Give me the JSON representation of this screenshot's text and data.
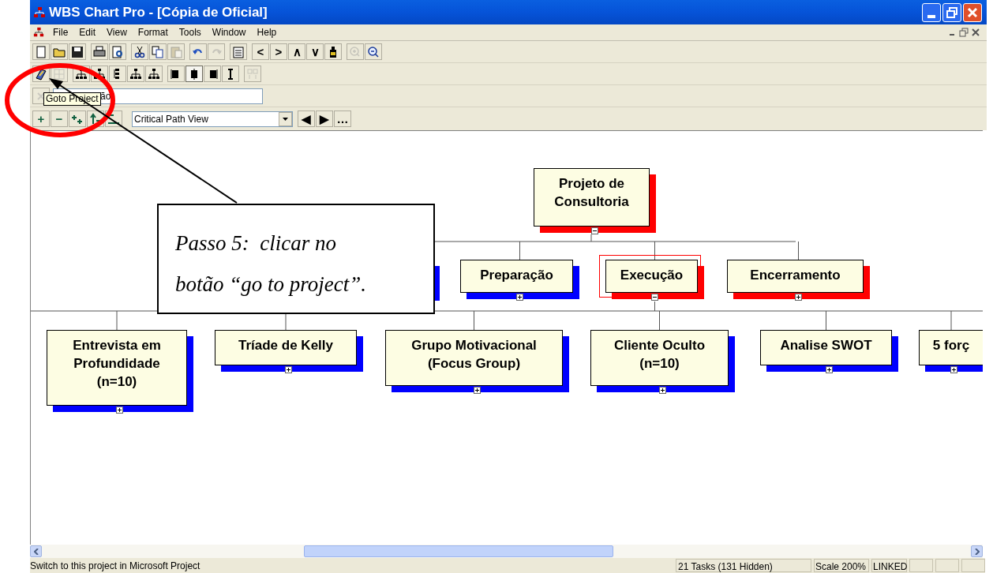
{
  "window": {
    "title": "WBS Chart Pro - [Cópia de Oficial]"
  },
  "menu": [
    "File",
    "Edit",
    "View",
    "Format",
    "Tools",
    "Window",
    "Help"
  ],
  "toolbar_1": [
    [
      {
        "kind": "icon",
        "disabled": false
      },
      {
        "kind": "icon",
        "disabled": false
      },
      {
        "kind": "icon",
        "disabled": false
      }
    ],
    [
      {
        "kind": "icon",
        "disabled": false
      },
      {
        "kind": "icon",
        "disabled": false
      }
    ],
    [
      {
        "kind": "icon",
        "disabled": false
      },
      {
        "kind": "icon",
        "disabled": false
      },
      {
        "kind": "icon",
        "disabled": true
      }
    ],
    [
      {
        "kind": "icon",
        "disabled": false
      },
      {
        "kind": "icon",
        "disabled": true
      }
    ],
    [
      {
        "kind": "icon",
        "disabled": false
      }
    ],
    [
      {
        "kind": "glyph",
        "text": "<",
        "disabled": false
      },
      {
        "kind": "glyph",
        "text": ">",
        "disabled": false
      },
      {
        "kind": "glyph",
        "text": "∧",
        "disabled": false
      },
      {
        "kind": "glyph",
        "text": "∨",
        "disabled": false
      },
      {
        "kind": "icon",
        "disabled": false
      }
    ],
    [
      {
        "kind": "icon",
        "disabled": true
      },
      {
        "kind": "icon",
        "disabled": false
      }
    ]
  ],
  "toolbar_2": [
    [
      {
        "kind": "icon",
        "disabled": false,
        "selected": false
      },
      {
        "kind": "icon",
        "disabled": true,
        "selected": false
      }
    ],
    [
      {
        "kind": "icon",
        "disabled": false,
        "selected": false
      },
      {
        "kind": "icon",
        "disabled": false,
        "selected": false
      },
      {
        "kind": "icon",
        "disabled": false,
        "selected": false
      },
      {
        "kind": "icon",
        "disabled": false,
        "selected": false
      },
      {
        "kind": "icon",
        "disabled": false,
        "selected": false
      }
    ],
    [
      {
        "kind": "icon",
        "disabled": false,
        "selected": false
      },
      {
        "kind": "icon",
        "disabled": false,
        "selected": true
      },
      {
        "kind": "icon",
        "disabled": false,
        "selected": false
      },
      {
        "kind": "icon",
        "disabled": false,
        "selected": false
      }
    ],
    [
      {
        "kind": "icon",
        "disabled": true,
        "selected": false
      }
    ]
  ],
  "task_field": {
    "button_disabled": true,
    "value": "ão"
  },
  "toolbar_4": {
    "buttons": [
      {
        "kind": "glyph",
        "text": "+"
      },
      {
        "kind": "glyph",
        "text": "−"
      },
      {
        "kind": "icon"
      },
      {
        "kind": "icon"
      },
      {
        "kind": "icon"
      }
    ],
    "view_select": {
      "value": "Critical Path View"
    },
    "nav": [
      "◀",
      "▶",
      "…"
    ]
  },
  "tooltip": "Goto Project",
  "chart": {
    "root": {
      "label": "Projeto de Consultoria",
      "color": "#ff0000",
      "expanded": true,
      "selected": false,
      "children": [
        {
          "label": "Preparação",
          "color": "#0000ff",
          "expanded": false,
          "selected": false
        },
        {
          "label": "Execução",
          "color": "#ff0000",
          "expanded": true,
          "selected": true,
          "children": [
            {
              "label": "Entrevista em Profundidade (n=10)",
              "color": "#0000ff",
              "expanded": false,
              "selected": false
            },
            {
              "label": "Tríade de Kelly",
              "color": "#0000ff",
              "expanded": false,
              "selected": false
            },
            {
              "label": "Grupo Motivacional (Focus Group)",
              "color": "#0000ff",
              "expanded": false,
              "selected": false
            },
            {
              "label": "Cliente Oculto (n=10)",
              "color": "#0000ff",
              "expanded": false,
              "selected": false
            },
            {
              "label": "Analise SWOT",
              "color": "#0000ff",
              "expanded": false,
              "selected": false
            },
            {
              "label": "5 forç",
              "color": "#0000ff",
              "expanded": false,
              "selected": false
            }
          ]
        },
        {
          "label": "Encerramento",
          "color": "#ff0000",
          "expanded": false,
          "selected": false
        }
      ]
    }
  },
  "callout": {
    "lines": [
      "Passo 5:  clicar no",
      "botão “go to project”."
    ]
  },
  "status_bar": {
    "message": "Switch to this project in Microsoft Project",
    "tasks": "21 Tasks (131 Hidden)",
    "scale": "Scale 200%",
    "mode": "LINKED"
  }
}
